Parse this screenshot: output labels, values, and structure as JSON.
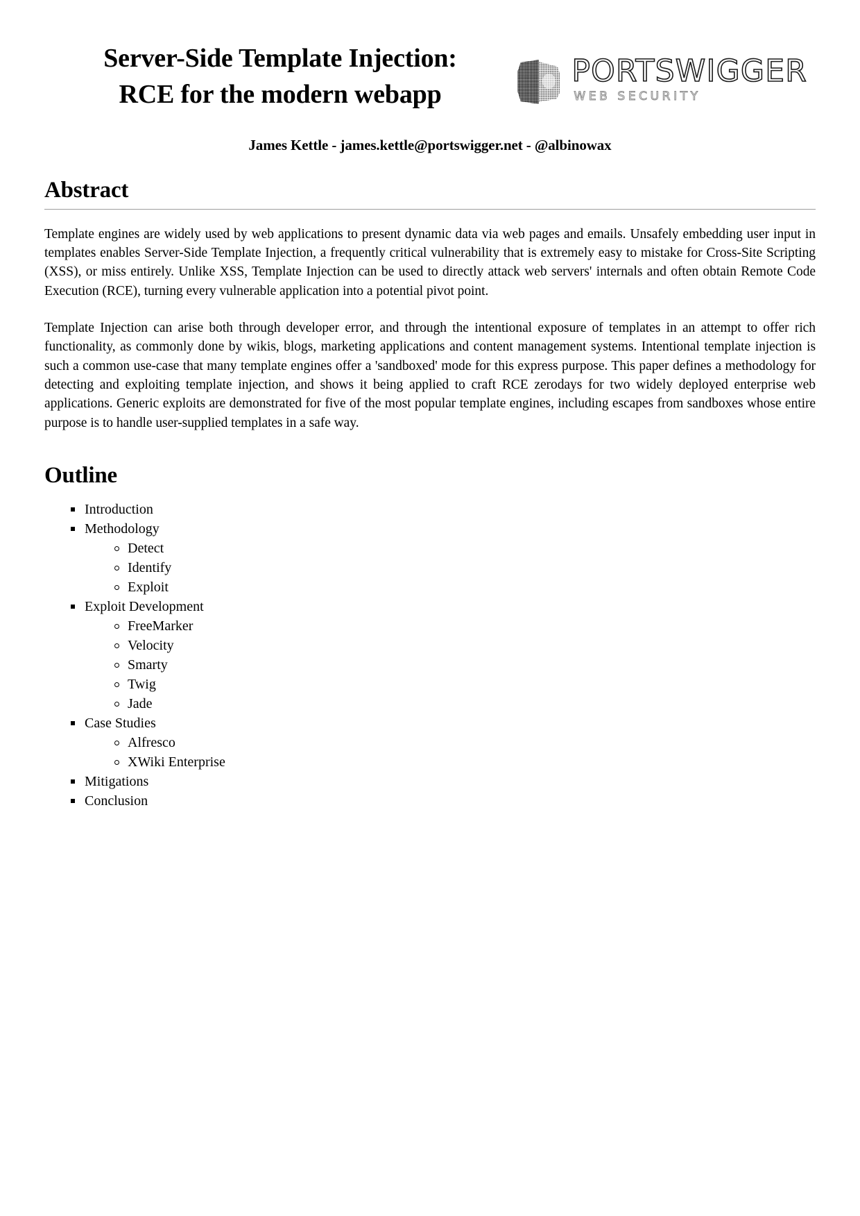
{
  "document": {
    "title": "Server-Side Template Injection:\nRCE for the modern webapp",
    "author_line": "James Kettle - james.kettle@portswigger.net - @albinowax"
  },
  "logo": {
    "wordmark": "PORTSWIGGER",
    "tagline": "WEB SECURITY",
    "mark_icon": "portswigger-cube-icon"
  },
  "abstract": {
    "heading": "Abstract",
    "paragraphs": [
      "Template engines are widely used by web applications to present dynamic data via web pages and emails. Unsafely embedding user input in templates enables Server-Side Template Injection, a frequently critical vulnerability that is extremely easy to mistake for Cross-Site Scripting (XSS), or miss entirely. Unlike XSS, Template Injection can be used to directly attack web servers' internals and often obtain Remote Code Execution (RCE), turning every vulnerable application into a potential pivot point.",
      "Template Injection can arise both through developer error, and through the intentional exposure of templates in an attempt to offer rich functionality, as commonly done by wikis, blogs, marketing applications and content management systems. Intentional template injection is such a common use-case that many template engines offer a 'sandboxed' mode for this express purpose. This paper defines a methodology for detecting and exploiting template injection, and shows it being applied to craft RCE zerodays for two widely deployed enterprise web applications. Generic exploits are demonstrated for five of the most popular template engines, including escapes from sandboxes whose entire purpose is to handle user-supplied templates in a safe way."
    ]
  },
  "outline": {
    "heading": "Outline",
    "items": [
      {
        "label": "Introduction",
        "children": []
      },
      {
        "label": "Methodology",
        "children": [
          {
            "label": "Detect"
          },
          {
            "label": "Identify"
          },
          {
            "label": "Exploit"
          }
        ]
      },
      {
        "label": "Exploit Development",
        "children": [
          {
            "label": "FreeMarker"
          },
          {
            "label": "Velocity"
          },
          {
            "label": "Smarty"
          },
          {
            "label": "Twig"
          },
          {
            "label": "Jade"
          }
        ]
      },
      {
        "label": "Case Studies",
        "children": [
          {
            "label": "Alfresco"
          },
          {
            "label": "XWiki Enterprise"
          }
        ]
      },
      {
        "label": "Mitigations",
        "children": []
      },
      {
        "label": "Conclusion",
        "children": []
      }
    ]
  },
  "colors": {
    "page_background": "#ffffff",
    "text": "#000000",
    "rule": "#9d9d9d",
    "logo_tagline": "#8a8a8a"
  }
}
